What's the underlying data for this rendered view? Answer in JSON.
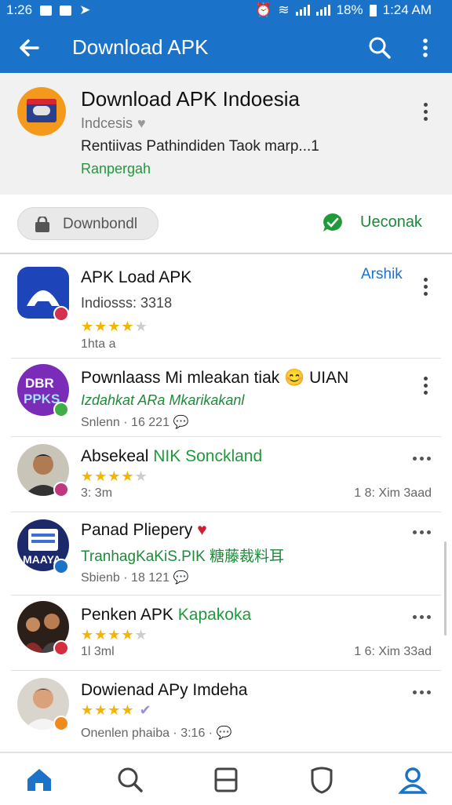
{
  "status": {
    "time": "1:24 AM",
    "left_text": "1:26",
    "battery": "18%"
  },
  "appbar": {
    "title": "Download APK"
  },
  "featured": {
    "title": "Download APK Indoesia",
    "subtitle": "Indcesis",
    "description": "Rentiivas Pathindiden Taok marp...1",
    "tag": "Ranpergah",
    "download_label": "Downbondl",
    "chat_label": "Ueconak"
  },
  "list": [
    {
      "title": "APK Load APK",
      "subtitle": "Indiosss: 3318",
      "rating": 3.5,
      "meta": "1hta a",
      "link": "Arshik"
    },
    {
      "title": "Pownlaass Mi mleakan tiak 😊 UIAN",
      "subtitle": "Izdahkat ARa Mkarikakanl",
      "meta": "Snlenn · 16 221"
    },
    {
      "title_a": "Absekeal",
      "title_b": "NIK Sonckland",
      "rating": 3.5,
      "meta": "3: 3m",
      "right": "1 8: Xim 3aad"
    },
    {
      "title": "Panad Pliepery",
      "subtitle": "TranhagKaKiS.PIK 糖藤裁料耳",
      "meta": "Sbienb · 18 121"
    },
    {
      "title_a": "Penken APK",
      "title_b": "Kapakoka",
      "rating": 3.5,
      "meta": "1l 3ml",
      "right": "1 6: Xim 33ad"
    },
    {
      "title": "Dowienad APy Imdeha",
      "rating": 4,
      "meta": "Onenlen phaiba · 3:16 · "
    }
  ],
  "colors": {
    "primary": "#1a73c8",
    "accent_green": "#1e9a3a",
    "star": "#f4b400"
  },
  "icons": [
    "back-arrow-icon",
    "search-icon",
    "more-vert-icon",
    "heart-icon",
    "lock-icon",
    "chat-check-icon",
    "home-icon",
    "tablet-icon",
    "shield-icon",
    "profile-icon"
  ]
}
